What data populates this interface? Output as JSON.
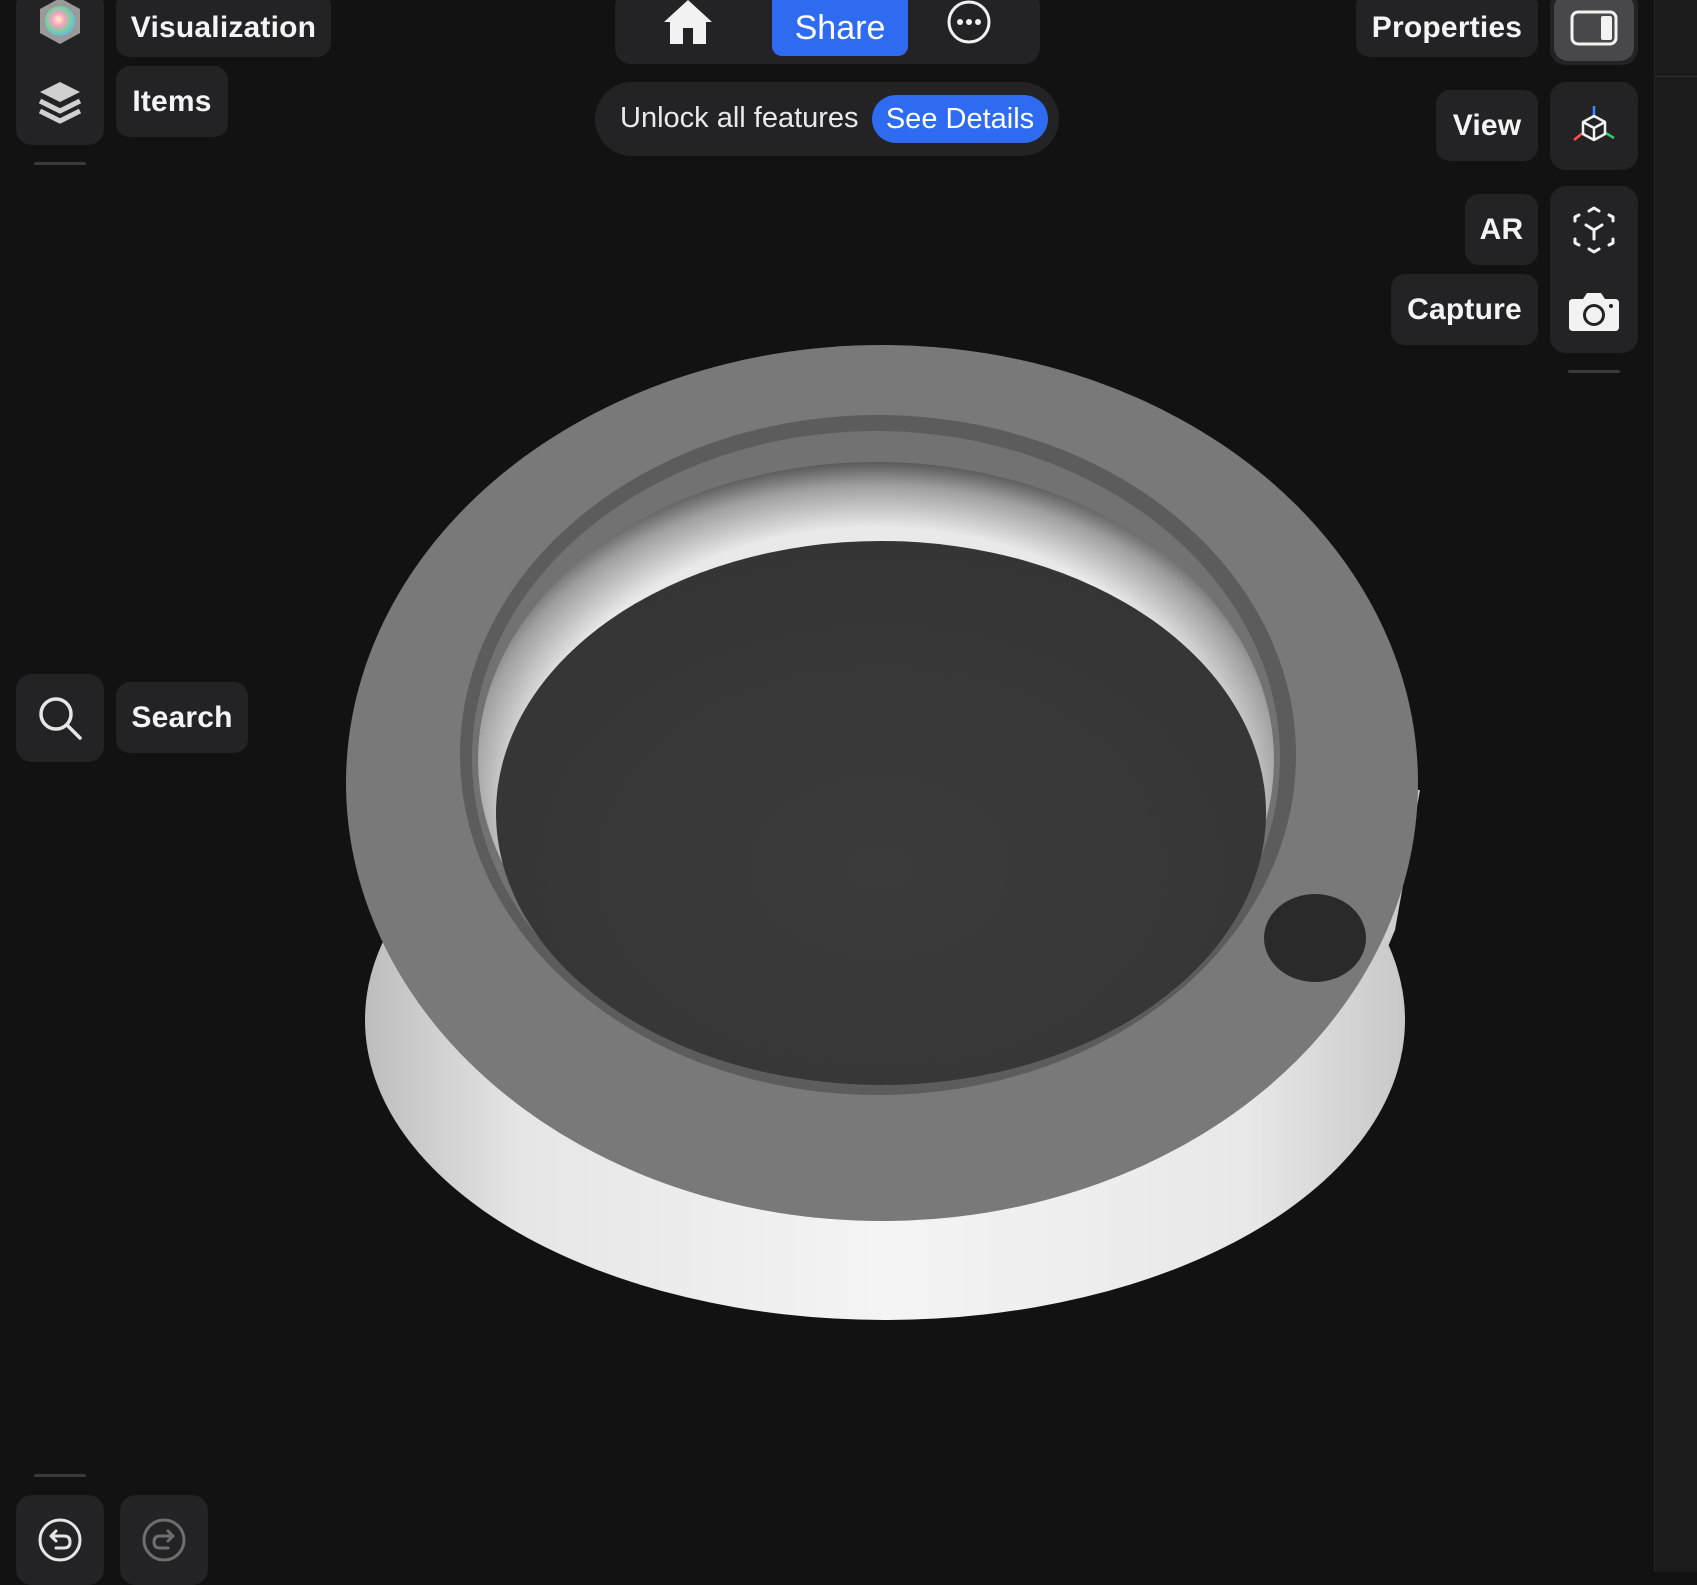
{
  "left_toolbar": {
    "visualization_label": "Visualization",
    "items_label": "Items",
    "search_label": "Search"
  },
  "top_toolbar": {
    "share_label": "Share"
  },
  "promo_banner": {
    "text": "Unlock all features",
    "button_label": "See Details"
  },
  "right_toolbar": {
    "properties_label": "Properties",
    "view_label": "View",
    "ar_label": "AR",
    "capture_label": "Capture"
  },
  "icons": [
    "color-wheel-icon",
    "layers-icon",
    "search-icon",
    "home-icon",
    "more-icon",
    "sidebar-toggle-icon",
    "axis-cube-icon",
    "ar-cube-icon",
    "camera-icon",
    "undo-icon",
    "redo-icon"
  ],
  "colors": {
    "background": "#121212",
    "panel": "#232325",
    "accent_blue": "#2f6bf0"
  }
}
